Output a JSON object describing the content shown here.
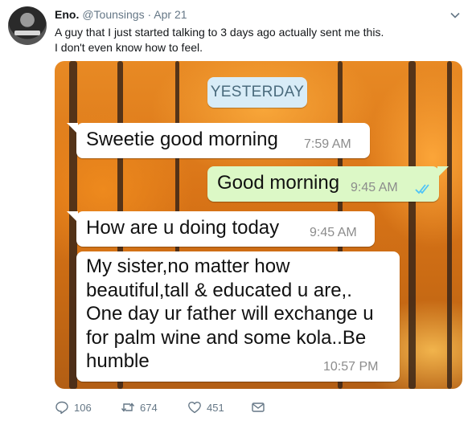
{
  "tweet": {
    "name": "Eno.",
    "handle": "@Tounsings",
    "separator": "·",
    "date": "Apr 21",
    "text_line1": "A guy that I just started talking to 3 days ago actually sent me this.",
    "text_line2": "I don't even know how to feel."
  },
  "chat": {
    "date_pill": "YESTERDAY",
    "messages": [
      {
        "direction": "incoming",
        "text": "Sweetie good morning",
        "time": "7:59 AM"
      },
      {
        "direction": "outgoing",
        "text": "Good morning",
        "time": "9:45 AM",
        "status": "read-double-tick"
      },
      {
        "direction": "incoming",
        "text": "How are  u doing today",
        "time": "9:45 AM"
      },
      {
        "direction": "incoming",
        "text": "My sister,no matter how\nbeautiful,tall & educated u are,.\nOne day ur father will exchange u\nfor palm wine and some kola..Be\nhumble",
        "time": "10:57 PM"
      }
    ]
  },
  "actions": {
    "reply_count": "106",
    "retweet_count": "674",
    "like_count": "451"
  },
  "colors": {
    "accent": "#1da1f2",
    "muted": "#657786",
    "outgoing_bubble": "#dcf8c6",
    "date_pill": "#d8ecf7",
    "read_tick": "#4fc3f7"
  },
  "icons": [
    "caret-down-icon",
    "reply-icon",
    "retweet-icon",
    "like-icon",
    "direct-message-icon",
    "double-tick-icon"
  ]
}
